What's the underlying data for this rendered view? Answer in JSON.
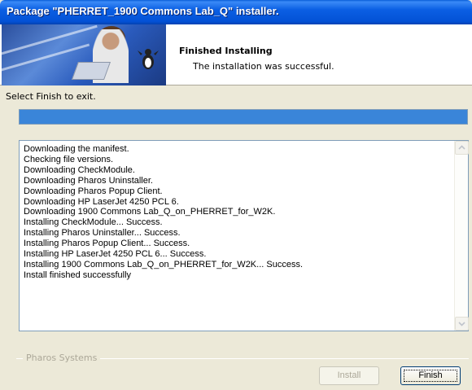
{
  "window": {
    "title": "Package \"PHERRET_1900 Commons Lab_Q\" installer."
  },
  "header": {
    "title": "Finished Installing",
    "subtitle": "The installation was successful."
  },
  "instruction": "Select Finish to exit.",
  "progress": {
    "percent": 100,
    "color": "#3a85d9"
  },
  "log": {
    "lines": [
      "Downloading the manifest.",
      "Checking file versions.",
      "Downloading CheckModule.",
      "Downloading Pharos Uninstaller.",
      "Downloading Pharos Popup Client.",
      "Downloading HP LaserJet 4250 PCL 6.",
      "Downloading 1900 Commons Lab_Q_on_PHERRET_for_W2K.",
      "Installing CheckModule... Success.",
      "Installing Pharos Uninstaller... Success.",
      "Installing Pharos Popup Client... Success.",
      "Installing HP LaserJet 4250 PCL 6... Success.",
      "Installing 1900 Commons Lab_Q_on_PHERRET_for_W2K... Success.",
      "Install finished successfully"
    ]
  },
  "footer": {
    "group_label": "Pharos Systems",
    "install_label": "Install",
    "finish_label": "Finish"
  },
  "icons": {
    "scroll_up": "chevron-up-icon",
    "scroll_down": "chevron-down-icon"
  }
}
